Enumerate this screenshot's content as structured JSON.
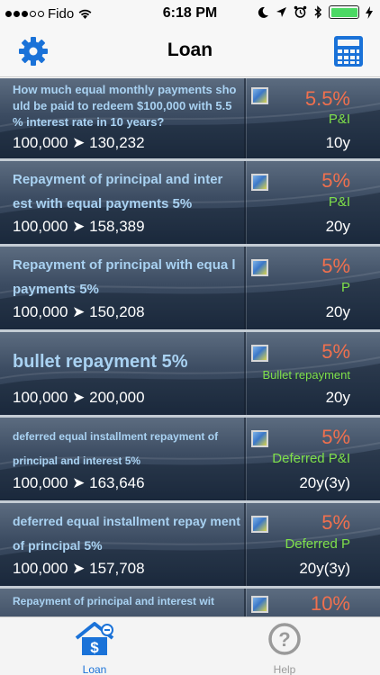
{
  "status": {
    "carrier": "Fido",
    "time": "6:18 PM"
  },
  "nav": {
    "title": "Loan"
  },
  "colors": {
    "accent": "#1a72d8",
    "rate": "#f0704e",
    "type": "#7fe04a",
    "title": "#a9d2f2"
  },
  "rows": [
    {
      "title": "How much equal monthly payments sho uld be paid to redeem $100,000 with 5.5 % interest rate in 10 years?",
      "amount": "100,000 ➤ 130,232",
      "rate": "5.5%",
      "type": "P&I",
      "term": "10y"
    },
    {
      "title": "Repayment of principal and inter est with equal payments 5%",
      "amount": "100,000 ➤ 158,389",
      "rate": "5%",
      "type": "P&I",
      "term": "20y"
    },
    {
      "title": "Repayment of principal with equa l payments 5%",
      "amount": "100,000 ➤ 150,208",
      "rate": "5%",
      "type": "P",
      "term": "20y"
    },
    {
      "title": "bullet repayment 5%",
      "amount": "100,000 ➤ 200,000",
      "rate": "5%",
      "type": "Bullet repayment",
      "term": "20y"
    },
    {
      "title": "deferred equal installment repayment of principal and interest 5%",
      "amount": "100,000 ➤ 163,646",
      "rate": "5%",
      "type": "Deferred P&I",
      "term": "20y(3y)"
    },
    {
      "title": "deferred equal installment repay ment of principal 5%",
      "amount": "100,000 ➤ 157,708",
      "rate": "5%",
      "type": "Deferred P",
      "term": "20y(3y)"
    },
    {
      "title": "Repayment of principal and interest wit",
      "amount": "",
      "rate": "10%",
      "type": "",
      "term": ""
    }
  ],
  "tabs": {
    "loan": "Loan",
    "help": "Help"
  }
}
